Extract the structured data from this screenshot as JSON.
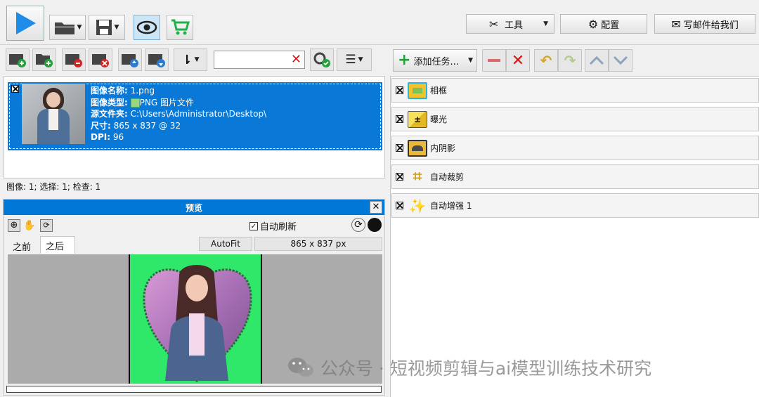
{
  "toolbar": {
    "tools_label": "工具",
    "config_label": "配置",
    "email_label": "写邮件给我们"
  },
  "search": {
    "value": "",
    "placeholder": ""
  },
  "image_item": {
    "name_label": "图像名称:",
    "name_value": "1.png",
    "type_label": "图像类型:",
    "type_value": "PNG 图片文件",
    "type_badge": "PNG",
    "source_label": "源文件夹:",
    "source_value": "C:\\Users\\Administrator\\Desktop\\",
    "size_label": "尺寸:",
    "size_value": "865 x 837 @ 32",
    "dpi_label": "DPI:",
    "dpi_value": "96"
  },
  "status_bar": {
    "text": "图像: 1; 选择: 1; 检查: 1"
  },
  "preview": {
    "title": "预览",
    "auto_refresh_label": "自动刷新",
    "tab_before": "之前",
    "tab_after": "之后",
    "autofit_label": "AutoFit",
    "dimensions": "865 x 837 px"
  },
  "tasks": {
    "add_task_label": "添加任务...",
    "items": [
      {
        "label": "相框",
        "checked": true,
        "icon": "frame-icon"
      },
      {
        "label": "曝光",
        "checked": true,
        "icon": "exposure-icon"
      },
      {
        "label": "内阴影",
        "checked": true,
        "icon": "inner-shadow-icon"
      },
      {
        "label": "自动裁剪",
        "checked": true,
        "icon": "crop-icon"
      },
      {
        "label": "自动增强 1",
        "checked": true,
        "icon": "magic-wand-icon"
      }
    ]
  },
  "watermark": {
    "text": "公众号 · 短视频剪辑与ai模型训练技术研究"
  },
  "colors": {
    "selection_blue": "#0a78d7",
    "preview_header_blue": "#0078d7",
    "green_bg": "#2fe86a",
    "play_blue": "#1e8ce8"
  }
}
